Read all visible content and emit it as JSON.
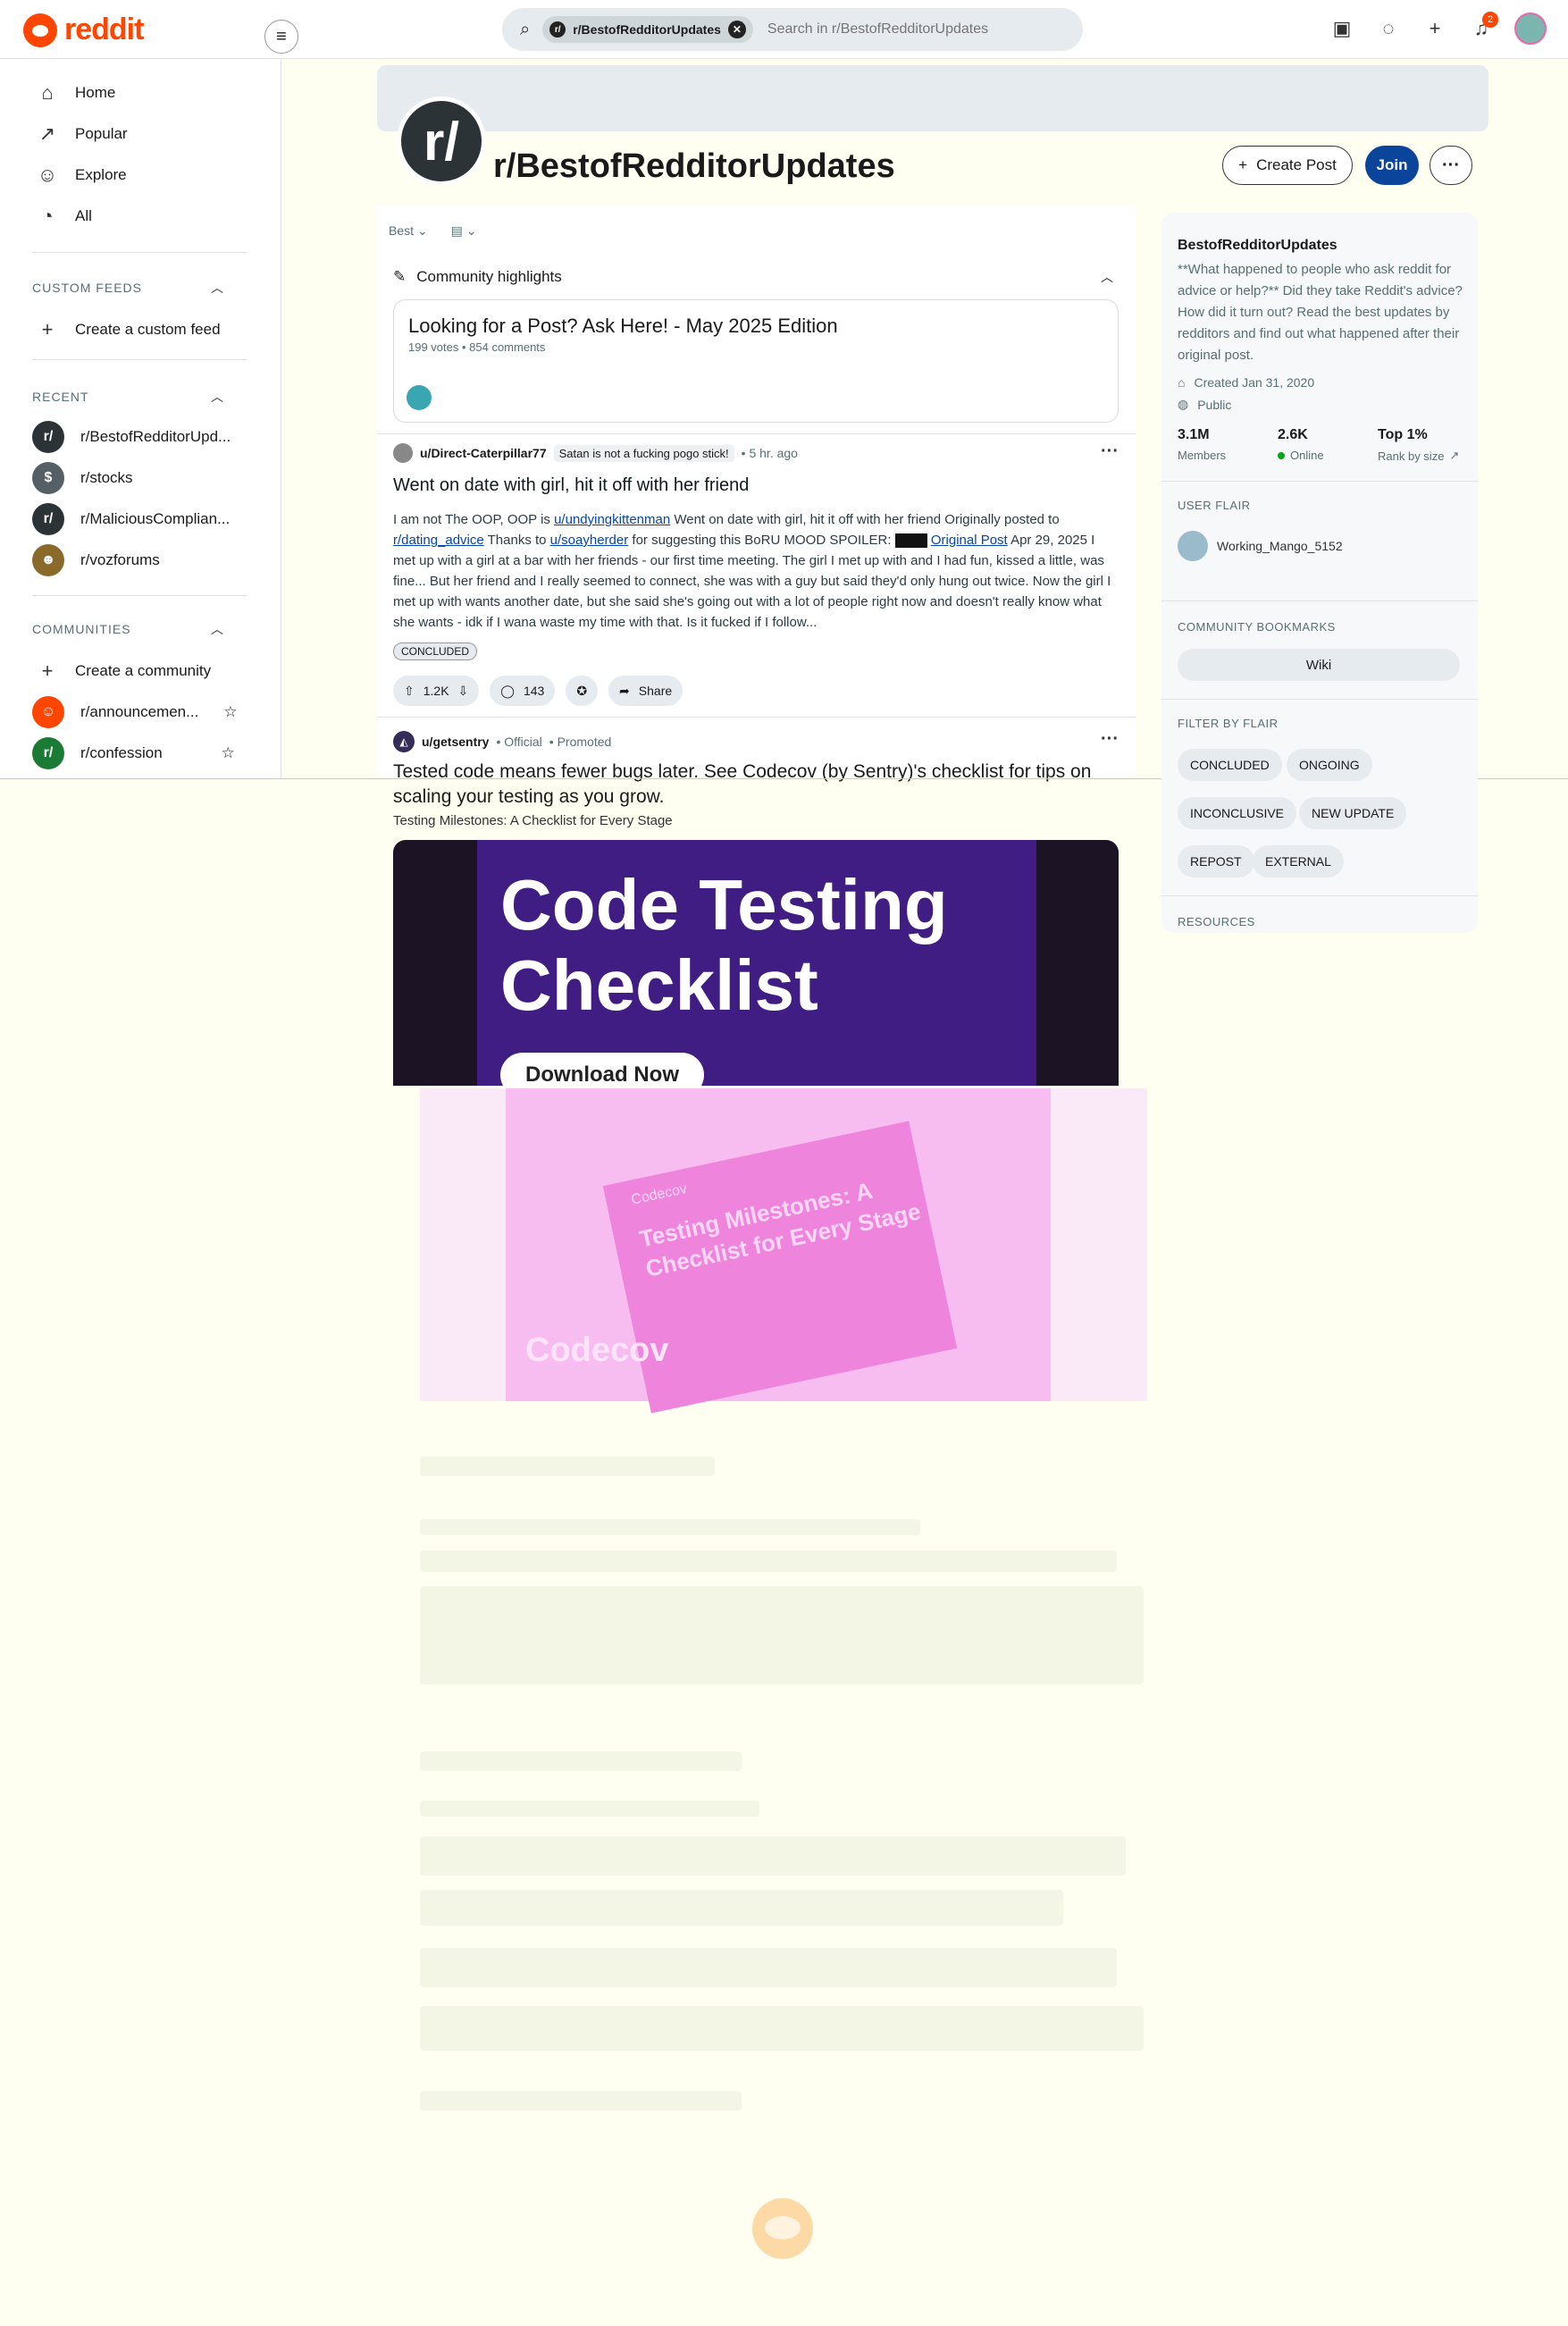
{
  "header": {
    "logo_text": "reddit",
    "search_chip": "r/BestofRedditorUpdates",
    "search_placeholder": "Search in r/BestofRedditorUpdates",
    "notification_count": "2"
  },
  "sidebar": {
    "nav": [
      "Home",
      "Popular",
      "Explore",
      "All"
    ],
    "custom_feeds_head": "CUSTOM FEEDS",
    "create_custom_feed": "Create a custom feed",
    "recent_head": "RECENT",
    "recent": [
      "r/BestofRedditorUpd...",
      "r/stocks",
      "r/MaliciousComplian...",
      "r/vozforums"
    ],
    "communities_head": "COMMUNITIES",
    "create_community": "Create a community",
    "communities": [
      "r/announcemen...",
      "r/confession"
    ]
  },
  "subreddit": {
    "avatar_text": "r/",
    "title": "r/BestofRedditorUpdates",
    "create_post": "Create Post",
    "join": "Join"
  },
  "feed": {
    "sort": "Best",
    "highlights_label": "Community highlights",
    "highlight_title": "Looking for a Post? Ask Here! - May 2025 Edition",
    "highlight_meta": "199 votes • 854 comments",
    "post": {
      "author": "u/Direct-Caterpillar77",
      "user_flair": "Satan is not a fucking pogo stick!",
      "time": "• 5 hr. ago",
      "title": "Went on date with girl, hit it off with her friend",
      "body_1": "I am not The OOP, OOP is ",
      "link_1": "u/undyingkittenman",
      "body_2": " Went on date with girl, hit it off with her friend Originally posted to ",
      "link_2": "r/dating_advice",
      "body_3": " Thanks to ",
      "link_3": "u/soayherder",
      "body_4": " for suggesting this BoRU MOOD SPOILER: ",
      "link_4": "Original Post",
      "body_5": " Apr 29, 2025 I met up with a girl at a bar with her friends - our first time meeting. The girl I met up with and I had fun, kissed a little, was fine... But her friend and I really seemed to connect, she was with a guy but said they'd only hung out twice. Now the girl I met up with wants another date, but she said she's going out with a lot of people right now and doesn't really know what she wants - idk if I wana waste my time with that. Is it fucked if I follow...",
      "tag": "CONCLUDED",
      "votes": "1.2K",
      "comments": "143",
      "share": "Share"
    },
    "ad": {
      "author": "u/getsentry",
      "official": "• Official",
      "promoted": "• Promoted",
      "title": "Tested code means fewer bugs later. See Codecov (by Sentry)'s checklist for tips on scaling your testing as you grow.",
      "subtitle": "Testing Milestones: A Checklist for Every Stage",
      "headline_1": "Code Testing",
      "headline_2": "Checklist",
      "download": "Download Now",
      "card_brand": "Codecov",
      "card_title": "Testing Milestones: A Checklist for Every Stage",
      "brand_faded": "Codecov"
    }
  },
  "about": {
    "name": "BestofRedditorUpdates",
    "description": "**What happened to people who ask reddit for advice or help?** Did they take Reddit's advice? How did it turn out? Read the best updates by redditors and find out what happened after their original post.",
    "created": "Created Jan 31, 2020",
    "visibility": "Public",
    "members_count": "3.1M",
    "members_label": "Members",
    "online_count": "2.6K",
    "online_label": "Online",
    "rank_value": "Top 1%",
    "rank_label": "Rank by size",
    "user_flair_head": "USER FLAIR",
    "username": "Working_Mango_5152",
    "bookmarks_head": "COMMUNITY BOOKMARKS",
    "wiki": "Wiki",
    "filter_head": "FILTER BY FLAIR",
    "flairs": [
      "CONCLUDED",
      "ONGOING",
      "INCONCLUSIVE",
      "NEW UPDATE",
      "REPOST",
      "EXTERNAL"
    ],
    "resources_head": "RESOURCES"
  }
}
